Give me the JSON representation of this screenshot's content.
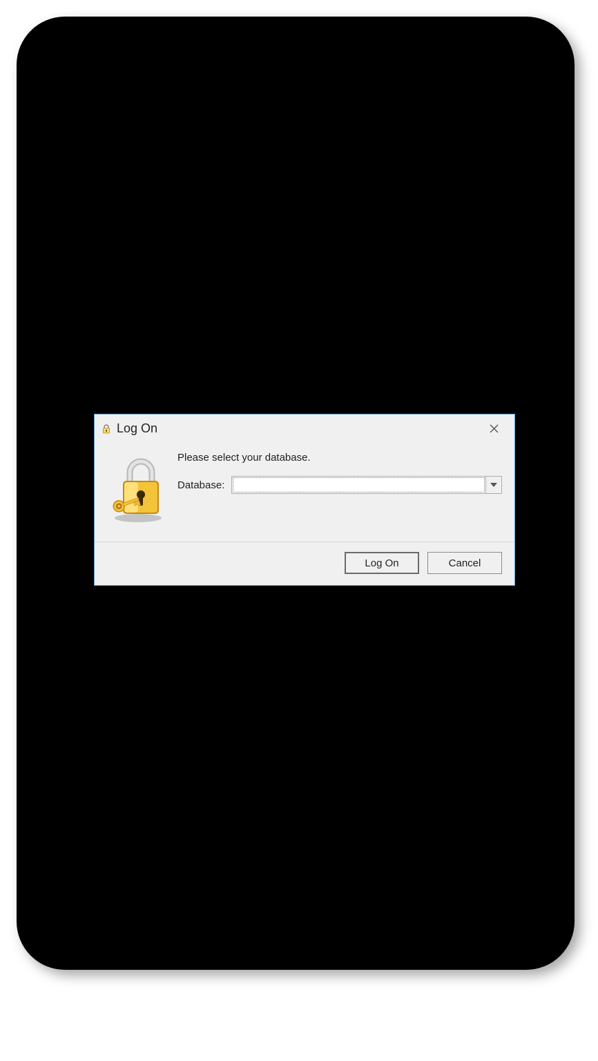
{
  "dialog": {
    "title": "Log On",
    "instruction": "Please select your database.",
    "database_label": "Database:",
    "database_value": "",
    "buttons": {
      "logon": "Log On",
      "cancel": "Cancel"
    }
  }
}
